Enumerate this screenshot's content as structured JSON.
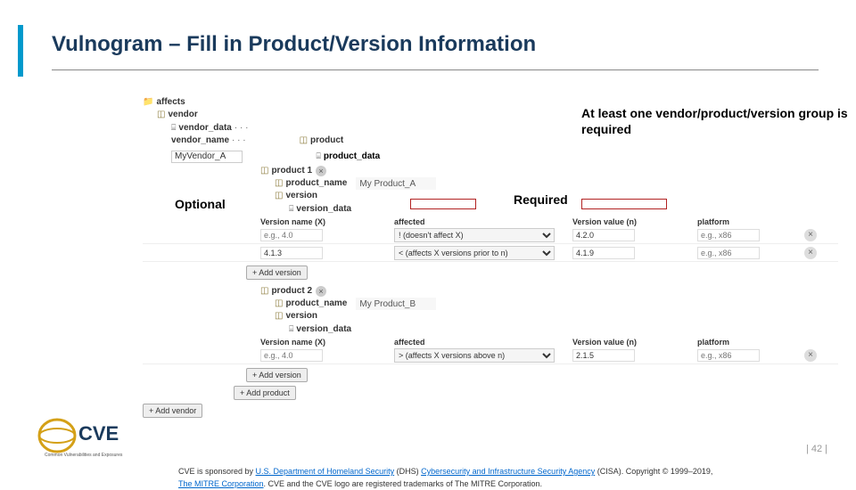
{
  "title": "Vulnogram – Fill in Product/Version Information",
  "annotations": {
    "at_least": "At least one vendor/product/version group is required",
    "optional": "Optional",
    "required": "Required"
  },
  "tree": {
    "affects": "affects",
    "vendor": "vendor",
    "vendor_data": "vendor_data",
    "vendor_name": "vendor_name",
    "vendor_name_value": "MyVendor_A",
    "product": "product",
    "product_data": "product_data",
    "product1": "product 1",
    "product_name": "product_name",
    "product_a_value": "My Product_A",
    "product2": "product 2",
    "product_b_value": "My Product_B",
    "version": "version",
    "version_data": "version_data",
    "dots": "· · ·"
  },
  "grid": {
    "h_version_name": "Version name (X)",
    "h_affected": "affected",
    "h_version_value": "Version value (n)",
    "h_platform": "platform",
    "ph_version": "e.g., 4.0",
    "ph_platform": "e.g., x86",
    "sel_none": "! (doesn't affect X)",
    "sel_prior": "< (affects X versions prior to n)",
    "sel_above": "> (affects X versions above n)",
    "row_a1_v": "4.1.3",
    "row_a1_val": "4.2.0",
    "row_a2_val": "4.1.9",
    "row_b_val": "2.1.5"
  },
  "buttons": {
    "add_version": "+ Add version",
    "add_product": "+ Add product",
    "add_vendor": "+ Add vendor"
  },
  "footer": {
    "page": "| 42 |",
    "line1a": "CVE is sponsored by ",
    "link1": "U.S. Department of Homeland Security",
    "line1b": " (DHS) ",
    "link2": "Cybersecurity and Infrastructure Security Agency",
    "line1c": " (CISA). Copyright © 1999–2019, ",
    "link3": "The MITRE Corporation",
    "line2": ". CVE and the CVE logo are registered trademarks of The MITRE Corporation."
  }
}
